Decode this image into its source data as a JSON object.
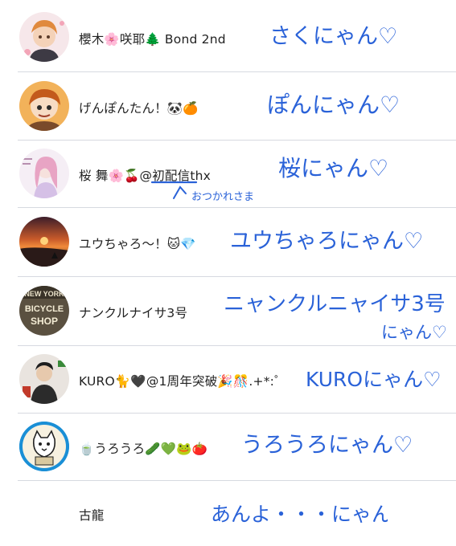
{
  "list": {
    "items": [
      {
        "name": "櫻木🌸咲耶🌲 Bond 2nd",
        "note": "さくにゃん♡"
      },
      {
        "name": "げんぽんたん！🐼🍊",
        "note": "ぽんにゃん♡"
      },
      {
        "name": "桜 舞🌸🍒@初配信thx",
        "note": "桜にゃん♡",
        "sub_note": "おつかれさま"
      },
      {
        "name": "ユウちゃろ～！🐱💎",
        "note": "ユウちゃろにゃん♡"
      },
      {
        "name": "ナンクルナイサ3号",
        "note": "ニャンクルニャイサ3号",
        "note_line2": "にゃん♡",
        "avatar_text": [
          "NEW YORK",
          "BICYCLE",
          "SHOP"
        ]
      },
      {
        "name": "KURO🐈🖤@1周年突破🎉🎊.+*:゜",
        "note": "KUROにゃん♡"
      },
      {
        "name": "🍵うろうろ🥒💚🐸🍅",
        "note": "うろうろにゃん♡"
      },
      {
        "name": "古龍",
        "note": "あんよ・・・にゃん"
      }
    ]
  },
  "colors": {
    "handwriting": "#2a62d8",
    "divider": "#d6d9e0",
    "text": "#222222"
  }
}
